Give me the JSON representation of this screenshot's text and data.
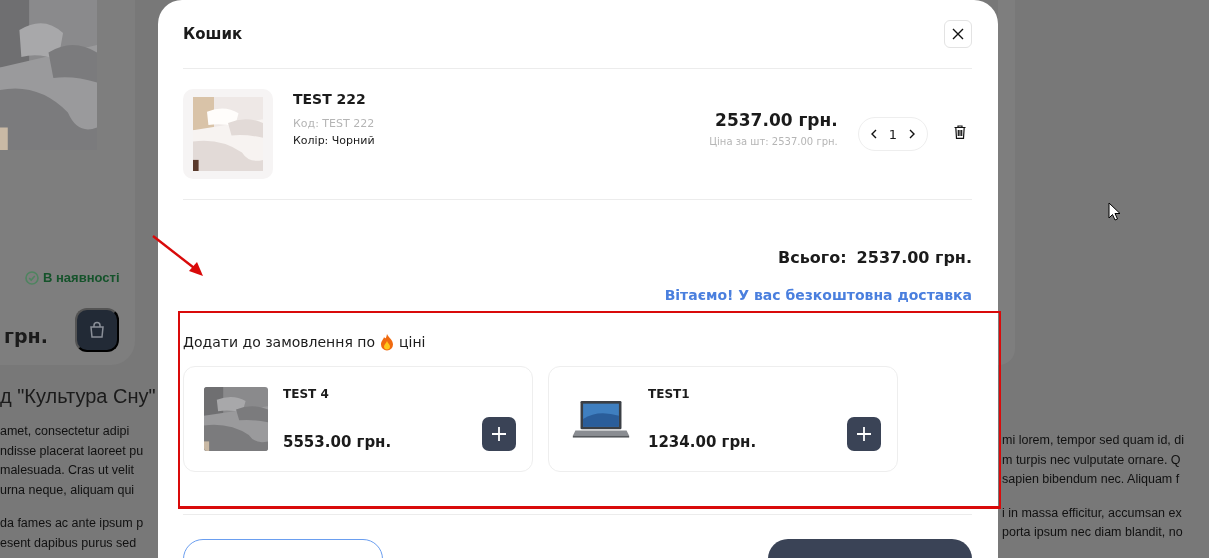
{
  "background_page": {
    "stock_status": "В наявності",
    "price": "грн.",
    "heading": "д \"Культура Сну\"",
    "text_left": [
      [
        "amet, consectetur adipi",
        "ndisse placerat laoreet pu",
        "malesuada. Cras ut velit",
        "urna neque, aliquam qui"
      ],
      [
        "da fames ac ante ipsum p",
        "esent dapibus purus sed"
      ]
    ],
    "text_right": [
      [
        "mi lorem, tempor sed quam id, di",
        "m turpis nec vulputate ornare. Q",
        "sapien bibendum nec. Aliquam f"
      ],
      [
        "i in massa efficitur, accumsan ex",
        "porta ipsum nec diam blandit, no"
      ]
    ]
  },
  "cart_modal": {
    "title": "Кошик",
    "items": [
      {
        "name": "TEST 222",
        "code": "Код: TEST 222",
        "colour_line": "Колір: Чорний",
        "price": "2537.00 грн.",
        "unit_price": "Ціна за шт: 2537.00 грн.",
        "quantity": "1"
      }
    ],
    "total_label": "Всього:",
    "total": "2537.00 грн.",
    "delivery_note": "Вітаємо! У вас безкоштовна доставка",
    "upsell": {
      "heading_before": "Додати до замовлення по",
      "heading_after": "ціні",
      "products": [
        {
          "name": "TEST 4",
          "price": "5553.00 грн.",
          "kind": "bedding"
        },
        {
          "name": "TEST1",
          "price": "1234.00 грн.",
          "kind": "laptop"
        }
      ]
    }
  }
}
